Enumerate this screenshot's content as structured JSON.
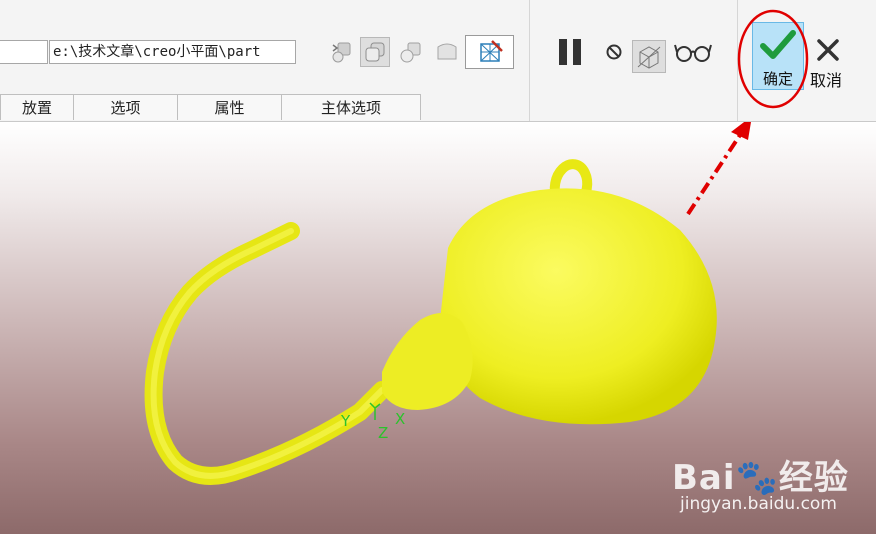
{
  "paths": {
    "left_field": "",
    "file_path": "e:\\技术文章\\creo小平面\\part"
  },
  "tabs": [
    {
      "label": "放置"
    },
    {
      "label": "选项"
    },
    {
      "label": "属性"
    },
    {
      "label": "主体选项"
    }
  ],
  "geometry_tools": [
    "create-copy-icon",
    "solid-body-icon",
    "paste-body-icon",
    "surface-icon",
    "mesh-preview-icon"
  ],
  "controls": {
    "pause_icon": "pause-icon",
    "stop_icon": "no-icon",
    "preview_icon": "wireframe-preview-icon",
    "glasses_icon": "glasses-icon"
  },
  "actions": {
    "confirm_label": "确定",
    "cancel_label": "取消"
  },
  "viewport": {
    "triad": {
      "x": "X",
      "y": "Y",
      "z": "Z"
    }
  },
  "watermark": {
    "logo_text": "Bai🐾经验",
    "url": "jingyan.baidu.com"
  },
  "colors": {
    "model": "#f0f02a",
    "confirm_bg": "#b8e2f8",
    "highlight": "#e00000",
    "triad": "#2cc22c"
  }
}
